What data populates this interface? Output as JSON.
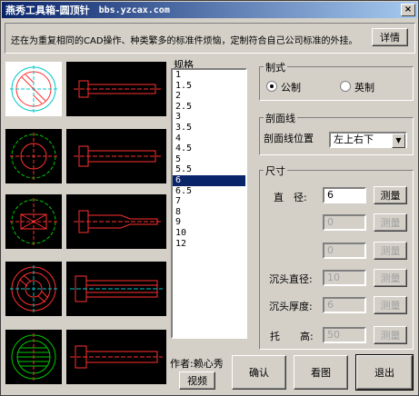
{
  "window": {
    "title": "燕秀工具箱-圆顶针",
    "url": "bbs.yzcax.com",
    "close_label": "×"
  },
  "notice": {
    "text": "还在为重复相同的CAD操作、种类繁多的标准件烦恼，定制符合自己公司标准的外挂。",
    "details_label": "详情"
  },
  "spec": {
    "legend": "规格",
    "items": [
      "1",
      "1.5",
      "2",
      "2.5",
      "3",
      "3.5",
      "4",
      "4.5",
      "5",
      "5.5",
      "6",
      "6.5",
      "7",
      "8",
      "9",
      "10",
      "12"
    ],
    "selected": "6"
  },
  "system": {
    "legend": "制式",
    "metric_label": "公制",
    "imperial_label": "英制",
    "selected": "metric"
  },
  "hatch": {
    "legend": "剖面线",
    "position_label": "剖面线位置",
    "position_value": "左上右下"
  },
  "size": {
    "legend": "尺寸",
    "diameter_label": "直　径:",
    "diameter_value": "6",
    "field2_value": "0",
    "field3_value": "0",
    "head_dia_label": "沉头直径:",
    "head_dia_value": "10",
    "head_thick_label": "沉头厚度:",
    "head_thick_value": "6",
    "lift_label": "托　　高:",
    "lift_value": "50",
    "measure_label": "测量"
  },
  "footer": {
    "author": "作者:赖心秀",
    "video_label": "视频",
    "confirm_label": "确认",
    "view_label": "看图",
    "exit_label": "退出"
  },
  "colors": {
    "title_start": "#0a246a",
    "title_end": "#a6caf0",
    "selection": "#0a246a",
    "drawing_bg": "#000000",
    "drawing_line": "#ff3030",
    "center_line": "#00c8c8",
    "green_line": "#00c800"
  }
}
